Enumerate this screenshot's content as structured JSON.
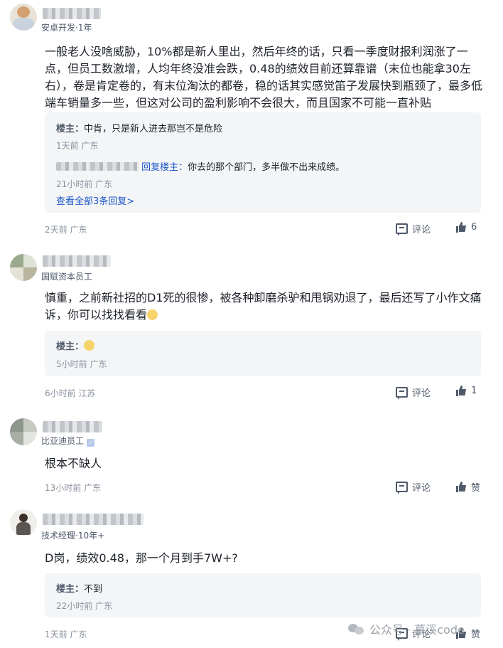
{
  "comments": [
    {
      "meta": "安卓开发·1年",
      "text": "一般老人没啥威胁，10%都是新人里出，然后年终的话，只看一季度财报利润涨了一点，但员工数激增，人均年终没准会跌，0.48的绩效目前还算靠谱（末位也能拿30左右），卷是肯定卷的，有末位淘汰的都卷，稳的话其实感觉笛子发展快到瓶颈了，最多低端车销量多一些，但这对公司的盈利影响不会很大，而且国家不可能一直补贴",
      "replies": [
        {
          "who": "楼主：",
          "text": "中肯，只是新人进去那岂不是危险",
          "time": "1天前 广东"
        },
        {
          "reply_link": "回复楼主：",
          "text": "你去的那个部门，多半做不出来成绩。",
          "time": "21小时前 广东"
        }
      ],
      "view_all": "查看全部3条回复>",
      "time": "2天前 广东",
      "comment_label": "评论",
      "like_count": "6"
    },
    {
      "meta": "国赋资本员工",
      "text": "慎重，之前新社招的D1死的很惨，被各种卸磨杀驴和甩锅劝退了，最后还写了小作文痛诉，你可以找找看看",
      "replies": [
        {
          "who": "楼主：",
          "text": "",
          "time": "5小时前 广东"
        }
      ],
      "time": "6小时前 江苏",
      "comment_label": "评论",
      "like_count": "1"
    },
    {
      "meta": "比亚迪员工",
      "text": "根本不缺人",
      "time": "13小时前 广东",
      "comment_label": "评论",
      "like_label": "赞"
    },
    {
      "meta": "技术经理·10年+",
      "text": "D岗，绩效0.48，那一个月到手7W+?",
      "replies": [
        {
          "who": "楼主：",
          "text": "不到",
          "time": "22小时前 广东"
        }
      ],
      "time": "1天前 广东",
      "comment_label": "评论",
      "like_label": "赞"
    }
  ],
  "watermark": "公众号 · 慕溪code",
  "icons": {
    "comment": "comment-bubble-icon",
    "like": "thumbs-up-icon",
    "verified": "verified-badge-icon",
    "emoji": "emoji-smile-icon"
  }
}
